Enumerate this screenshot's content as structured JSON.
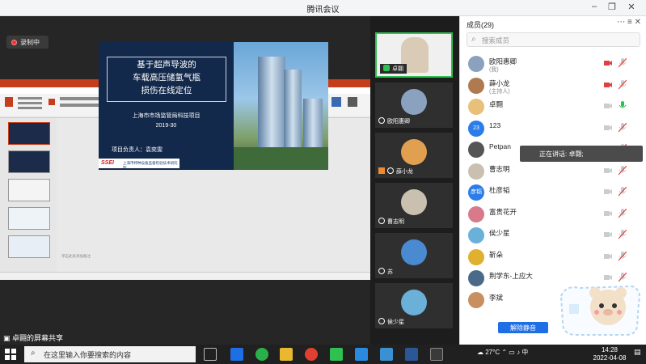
{
  "window": {
    "title": "腾讯会议"
  },
  "recording": {
    "label": "录制中"
  },
  "slide": {
    "title_line1": "基于超声导波的",
    "title_line2": "车载高压储氢气瓶",
    "title_line3": "损伤在线定位",
    "org": "上海市市场监管局科技项目",
    "date": "2019-30",
    "lead": "项目负责人：袁奕雯",
    "logo_text": "上海市特种设备监督检验技术研究院",
    "logo_mark": "SSEI",
    "notes": "单击此处添加备注"
  },
  "share": {
    "label": "卓翾的屏幕共享"
  },
  "videos": [
    {
      "name": "卓翾",
      "avatar_color": "#d9cbb6"
    },
    {
      "name": "欧阳惠卿",
      "avatar_color": "#8aa1bf"
    },
    {
      "name": "薛小龙",
      "avatar_color": "#e0a050"
    },
    {
      "name": "曹志明",
      "avatar_color": "#c9c0b0"
    },
    {
      "name": "苏",
      "avatar_color": "#4a8ad0"
    },
    {
      "name": "侯少星",
      "avatar_color": "#6ab0d8"
    }
  ],
  "panel": {
    "title": "成员(29)",
    "search_placeholder": "搜索成员",
    "members": [
      {
        "name": "欧阳惠卿",
        "sub": "(我)",
        "avatar_color": "#8aa1bf",
        "avatar_text": ""
      },
      {
        "name": "薛小龙",
        "sub": "(主持人)",
        "avatar_color": "#b07a50",
        "avatar_text": ""
      },
      {
        "name": "卓翾",
        "sub": "",
        "avatar_color": "#e8c07a",
        "avatar_text": ""
      },
      {
        "name": "123",
        "sub": "",
        "avatar_color": "#2b7de9",
        "avatar_text": "23"
      },
      {
        "name": "Petpan",
        "sub": "",
        "avatar_color": "#555555",
        "avatar_text": ""
      },
      {
        "name": "曹志明",
        "sub": "",
        "avatar_color": "#c9c0b0",
        "avatar_text": ""
      },
      {
        "name": "杜彦韬",
        "sub": "",
        "avatar_color": "#2b7de9",
        "avatar_text": "彦韬"
      },
      {
        "name": "富贵花开",
        "sub": "",
        "avatar_color": "#d87a8a",
        "avatar_text": ""
      },
      {
        "name": "侯少星",
        "sub": "",
        "avatar_color": "#6ab0d8",
        "avatar_text": ""
      },
      {
        "name": "靳朵",
        "sub": "",
        "avatar_color": "#e0b030",
        "avatar_text": ""
      },
      {
        "name": "荆学东-上应大",
        "sub": "",
        "avatar_color": "#4a6a8a",
        "avatar_text": ""
      },
      {
        "name": "李斌",
        "sub": "",
        "avatar_color": "#c89060",
        "avatar_text": ""
      }
    ],
    "speaking_label": "正在讲话: 卓翾;",
    "unmute_label": "解除静音"
  },
  "taskbar": {
    "search_placeholder": "在这里输入你要搜索的内容",
    "weather": "27°C",
    "ime": "中",
    "time": "14:28",
    "date": "2022-04-08"
  },
  "colors": {
    "accent": "#1e6fe6",
    "ppt_red": "#c43e1c",
    "slide_navy": "#13294b",
    "mic_active": "#2ec050",
    "mic_muted": "#e04040"
  }
}
